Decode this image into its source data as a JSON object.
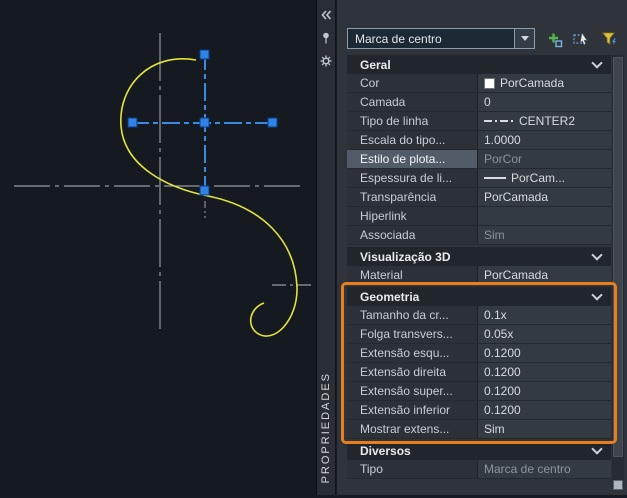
{
  "colors": {
    "orange_highlight": "#E87E1E",
    "selection_blue": "#3A8AE8",
    "grip_blue": "#2E82E8",
    "spline_yellow": "#E3E33C",
    "color_swatch": "#FFFFFF"
  },
  "palette": {
    "title": "PROPRIEDADES",
    "selector": {
      "value": "Marca de centro"
    },
    "titlebar_icons": [
      "auto-hide-icon",
      "pin-icon",
      "settings-icon"
    ],
    "toolbar_icons": [
      "pickadd-toggle-icon",
      "select-objects-icon",
      "quick-select-icon"
    ]
  },
  "sections": [
    {
      "title": "Geral",
      "rows": [
        {
          "label": "Cor",
          "value": "PorCamada",
          "swatch": "#FFFFFF"
        },
        {
          "label": "Camada",
          "value": "0"
        },
        {
          "label": "Tipo de linha",
          "value": "CENTER2",
          "linePreview": "centerline"
        },
        {
          "label": "Escala do tipo...",
          "value": "1.0000"
        },
        {
          "label": "Estilo de plota...",
          "value": "PorCor",
          "muted": true,
          "selectedLabel": true
        },
        {
          "label": "Espessura de li...",
          "value": "PorCam...",
          "linePreview": "solid"
        },
        {
          "label": "Transparência",
          "value": "PorCamada"
        },
        {
          "label": "Hiperlink",
          "value": ""
        },
        {
          "label": "Associada",
          "value": "Sim",
          "muted": true
        }
      ]
    },
    {
      "title": "Visualização 3D",
      "rows": [
        {
          "label": "Material",
          "value": "PorCamada"
        }
      ]
    },
    {
      "title": "Geometria",
      "highlighted": true,
      "rows": [
        {
          "label": "Tamanho da cr...",
          "value": "0.1x"
        },
        {
          "label": "Folga transvers...",
          "value": "0.05x"
        },
        {
          "label": "Extensão esqu...",
          "value": "0.1200"
        },
        {
          "label": "Extensão direita",
          "value": "0.1200"
        },
        {
          "label": "Extensão super...",
          "value": "0.1200"
        },
        {
          "label": "Extensão inferior",
          "value": "0.1200"
        },
        {
          "label": "Mostrar extens...",
          "value": "Sim"
        }
      ]
    },
    {
      "title": "Diversos",
      "rows": [
        {
          "label": "Tipo",
          "value": "Marca de centro",
          "muted": true
        }
      ]
    }
  ]
}
